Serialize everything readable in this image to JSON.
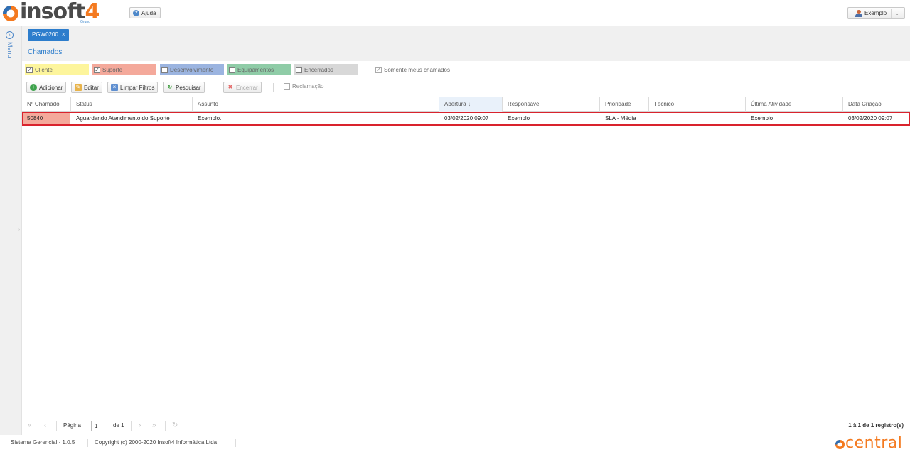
{
  "app": {
    "logo_text": "insoft",
    "logo_number": "4",
    "logo_sub": "Grupo",
    "help_label": "Ajuda",
    "user_label": "Exemplo"
  },
  "sidebar": {
    "menu_label": "Menu"
  },
  "tab": {
    "label": "PGW0200",
    "close": "×"
  },
  "page": {
    "title": "Chamados"
  },
  "filters": {
    "items": [
      {
        "label": "Cliente",
        "checked": true,
        "color": "#fdf59c"
      },
      {
        "label": "Suporte",
        "checked": true,
        "color": "#f4a99b"
      },
      {
        "label": "Desenvolvimento",
        "checked": false,
        "color": "#9bb4e0"
      },
      {
        "label": "Equipamentos",
        "checked": false,
        "color": "#8fcca7"
      },
      {
        "label": "Encerrados",
        "checked": false,
        "color": "#d8d8d8"
      }
    ],
    "only_mine": {
      "label": "Somente meus chamados",
      "checked": true
    }
  },
  "toolbar": {
    "add": "Adicionar",
    "edit": "Editar",
    "clear": "Limpar Filtros",
    "search": "Pesquisar",
    "close": "Encerrar",
    "complaint": "Reclamação"
  },
  "grid": {
    "columns": [
      "Nº Chamado",
      "Status",
      "Assunto",
      "Abertura ↓",
      "Responsável",
      "Prioridade",
      "Técnico",
      "Última Atividade",
      "Data Criação"
    ],
    "rows": [
      {
        "id": "50840",
        "status": "Aguardando Atendimento do Suporte",
        "subject": "Exemplo.",
        "opened": "03/02/2020 09:07",
        "owner": "Exemplo",
        "priority": "SLA - Média",
        "tech": "",
        "last_activity": "Exemplo",
        "created": "03/02/2020 09:07"
      }
    ]
  },
  "pager": {
    "page_label": "Página",
    "page_value": "1",
    "of_label": "de 1",
    "total": "1 à 1 de 1 registro(s)"
  },
  "footer": {
    "version": "Sistema Gerencial - 1.0.5",
    "copyright": "Copyright (c) 2000-2020 Insoft4 Informática Ltda",
    "brand": "central"
  },
  "colors": {
    "accent": "#2d7dcc",
    "brand_orange": "#f47a20",
    "highlight_border": "#d9232d"
  }
}
